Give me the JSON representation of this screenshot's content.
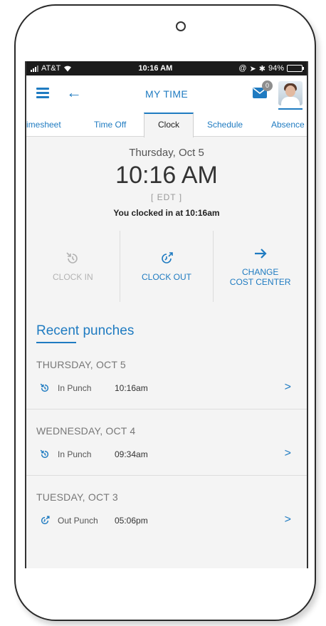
{
  "status_bar": {
    "carrier": "AT&T",
    "time": "10:16 AM",
    "battery": "94%",
    "battery_level": 0.94
  },
  "header": {
    "title": "MY TIME",
    "mail_badge": "0"
  },
  "tabs": [
    {
      "label": "imesheet"
    },
    {
      "label": "Time Off"
    },
    {
      "label": "Clock",
      "active": true
    },
    {
      "label": "Schedule"
    },
    {
      "label": "Absence"
    }
  ],
  "clock": {
    "date": "Thursday, Oct 5",
    "time": "10:16 AM",
    "timezone": "[ EDT ]",
    "status": "You clocked in at 10:16am"
  },
  "actions": {
    "clock_in": "CLOCK IN",
    "clock_out": "CLOCK OUT",
    "change_cost_center": "CHANGE\nCOST CENTER"
  },
  "recent": {
    "title": "Recent punches",
    "days": [
      {
        "header": "THURSDAY, OCT 5",
        "type": "In Punch",
        "time": "10:16am"
      },
      {
        "header": "WEDNESDAY, OCT 4",
        "type": "In Punch",
        "time": "09:34am"
      },
      {
        "header": "TUESDAY, OCT 3",
        "type": "Out Punch",
        "time": "05:06pm"
      }
    ]
  },
  "colors": {
    "accent": "#1f7bc1",
    "disabled": "#b3b3b3",
    "background": "#f4f4f4"
  }
}
